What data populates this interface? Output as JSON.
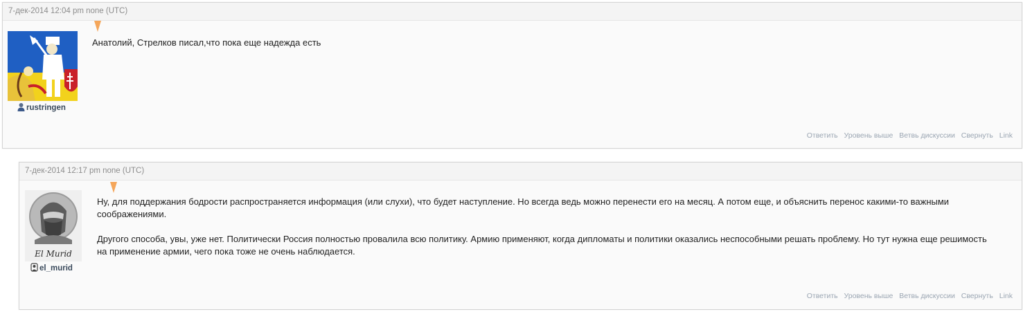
{
  "comments": [
    {
      "timestamp": "7-дек-2014 12:04 pm none (UTC)",
      "username": "rustringen",
      "avatar_icon": "heraldic-knight-avatar",
      "paragraphs": [
        "Анатолий, Стрелков писал,что пока еще надежда есть"
      ],
      "actions": [
        "Ответить",
        "Уровень выше",
        "Ветвь дискуссии",
        "Свернуть",
        "Link"
      ]
    },
    {
      "timestamp": "7-дек-2014 12:17 pm none (UTC)",
      "username": "el_murid",
      "avatar_icon": "el-murid-portrait-avatar",
      "avatar_caption": "El Murid",
      "paragraphs": [
        "Ну, для поддержания бодрости распространяется информация (или слухи), что будет наступление. Но всегда ведь можно перенести его на месяц. А потом еще, и объяснить перенос какими-то важными соображениями.",
        "Другого способа, увы, уже нет. Политически Россия полностью провалила всю политику. Армию применяют, когда дипломаты и политики оказались неспособными решать проблему. Но тут нужна еще решимость на применение армии, чего пока тоже не очень наблюдается."
      ],
      "actions": [
        "Ответить",
        "Уровень выше",
        "Ветвь дискуссии",
        "Свернуть",
        "Link"
      ]
    }
  ]
}
